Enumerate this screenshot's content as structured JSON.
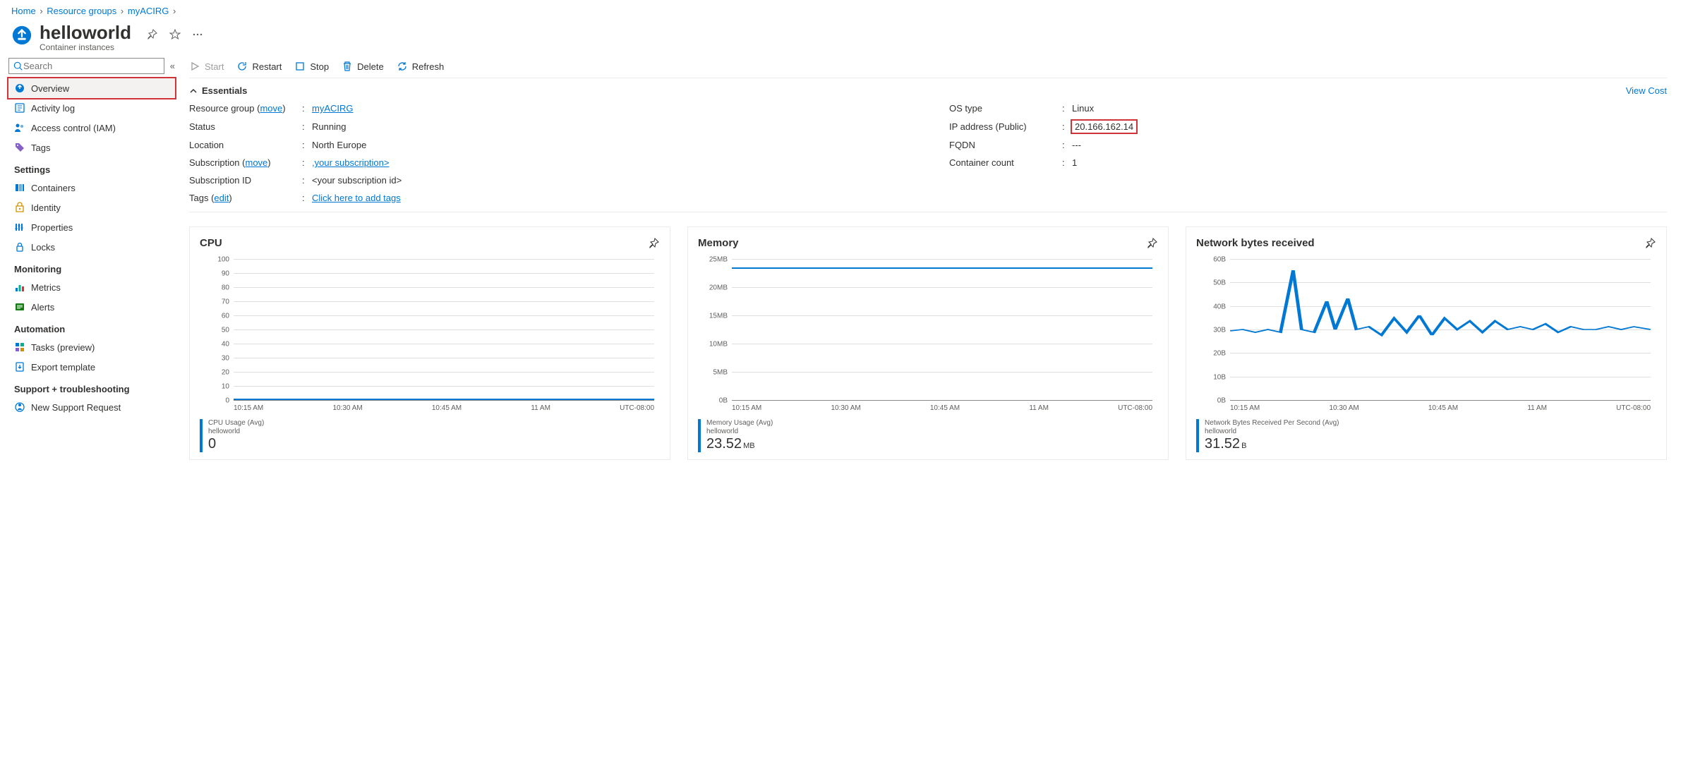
{
  "breadcrumb": {
    "home": "Home",
    "rg": "Resource groups",
    "rgname": "myACIRG"
  },
  "header": {
    "title": "helloworld",
    "subtitle": "Container instances"
  },
  "search": {
    "placeholder": "Search"
  },
  "nav": {
    "overview": "Overview",
    "activity": "Activity log",
    "iam": "Access control (IAM)",
    "tags": "Tags",
    "settings_hdr": "Settings",
    "containers": "Containers",
    "identity": "Identity",
    "properties": "Properties",
    "locks": "Locks",
    "monitoring_hdr": "Monitoring",
    "metrics": "Metrics",
    "alerts": "Alerts",
    "automation_hdr": "Automation",
    "tasks": "Tasks (preview)",
    "export": "Export template",
    "support_hdr": "Support + troubleshooting",
    "newsupport": "New Support Request"
  },
  "toolbar": {
    "start": "Start",
    "restart": "Restart",
    "stop": "Stop",
    "delete": "Delete",
    "refresh": "Refresh"
  },
  "essentials": {
    "label": "Essentials",
    "viewcost": "View Cost",
    "move": "move",
    "edit": "edit",
    "rg_l": "Resource group",
    "rg_v": "myACIRG",
    "status_l": "Status",
    "status_v": "Running",
    "loc_l": "Location",
    "loc_v": "North Europe",
    "sub_l": "Subscription",
    "sub_v": ",your subscription>",
    "subid_l": "Subscription ID",
    "subid_v": "<your subscription id>",
    "os_l": "OS type",
    "os_v": "Linux",
    "ip_l": "IP address (Public)",
    "ip_v": "20.166.162.14",
    "fqdn_l": "FQDN",
    "fqdn_v": "---",
    "cc_l": "Container count",
    "cc_v": "1",
    "tags_l": "Tags",
    "tags_v": "Click here to add tags"
  },
  "charts": {
    "cpu": {
      "title": "CPU",
      "legend_name": "CPU Usage (Avg)",
      "legend_sub": "helloworld",
      "value": "0",
      "unit": ""
    },
    "memory": {
      "title": "Memory",
      "legend_name": "Memory Usage (Avg)",
      "legend_sub": "helloworld",
      "value": "23.52",
      "unit": "MB"
    },
    "net": {
      "title": "Network bytes received",
      "legend_name": "Network Bytes Received Per Second (Avg)",
      "legend_sub": "helloworld",
      "value": "31.52",
      "unit": "B"
    },
    "xticks": {
      "t0": "10:15 AM",
      "t1": "10:30 AM",
      "t2": "10:45 AM",
      "t3": "11 AM",
      "tz": "UTC-08:00"
    },
    "yticks_cpu": {
      "y0": "0",
      "y1": "10",
      "y2": "20",
      "y3": "30",
      "y4": "40",
      "y5": "50",
      "y6": "60",
      "y7": "70",
      "y8": "80",
      "y9": "90",
      "y10": "100"
    },
    "yticks_mem": {
      "y0": "0B",
      "y1": "5MB",
      "y2": "10MB",
      "y3": "15MB",
      "y4": "20MB",
      "y5": "25MB"
    },
    "yticks_net": {
      "y0": "0B",
      "y1": "10B",
      "y2": "20B",
      "y3": "30B",
      "y4": "40B",
      "y5": "50B",
      "y6": "60B"
    }
  },
  "chart_data": [
    {
      "type": "line",
      "title": "CPU",
      "ylabel": "CPU Usage (Avg)",
      "ylim": [
        0,
        100
      ],
      "x": [
        "10:15 AM",
        "10:30 AM",
        "10:45 AM",
        "11 AM"
      ],
      "series": [
        {
          "name": "helloworld",
          "values": [
            0,
            0,
            0,
            0
          ]
        }
      ]
    },
    {
      "type": "line",
      "title": "Memory",
      "ylabel": "Memory Usage (Avg)",
      "ylim": [
        0,
        25
      ],
      "yunit": "MB",
      "x": [
        "10:15 AM",
        "10:30 AM",
        "10:45 AM",
        "11 AM"
      ],
      "series": [
        {
          "name": "helloworld",
          "values": [
            23.52,
            23.52,
            23.52,
            23.52
          ]
        }
      ]
    },
    {
      "type": "line",
      "title": "Network bytes received",
      "ylabel": "Network Bytes Received Per Second (Avg)",
      "ylim": [
        0,
        60
      ],
      "yunit": "B",
      "x": [
        "10:15 AM",
        "10:30 AM",
        "10:45 AM",
        "11 AM"
      ],
      "series": [
        {
          "name": "helloworld",
          "values": [
            30,
            55,
            30,
            30
          ]
        }
      ]
    }
  ]
}
